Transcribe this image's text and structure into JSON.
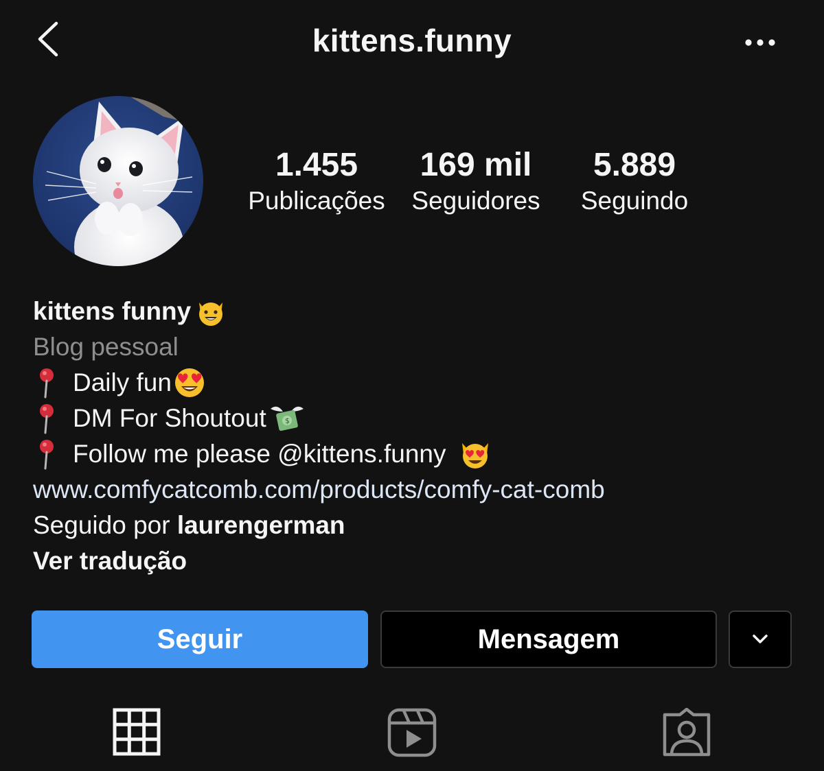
{
  "header": {
    "title": "kittens.funny",
    "back_icon": "chevron-left-icon",
    "more_icon": "more-horizontal-icon"
  },
  "profile": {
    "avatar_description": "white-kitten-avatar",
    "stats": [
      {
        "value": "1.455",
        "label": "Publicações"
      },
      {
        "value": "169 mil",
        "label": "Seguidores"
      },
      {
        "value": "5.889",
        "label": "Seguindo"
      }
    ],
    "name": "kittens funny",
    "category": "Blog pessoal",
    "bio_lines": [
      "Daily fun",
      "DM For Shoutout",
      "Follow me please @kittens.funny"
    ],
    "website": "www.comfycatcomb.com/products/comfy-cat-comb",
    "followed_by_prefix": "Seguido por ",
    "followed_by_user": "laurengerman",
    "translate_label": "Ver tradução"
  },
  "actions": {
    "follow_label": "Seguir",
    "message_label": "Mensagem",
    "follow_color": "#4195f0"
  },
  "tabs": [
    {
      "icon": "grid-icon",
      "active": true
    },
    {
      "icon": "reels-icon",
      "active": false
    },
    {
      "icon": "tagged-icon",
      "active": false
    }
  ]
}
